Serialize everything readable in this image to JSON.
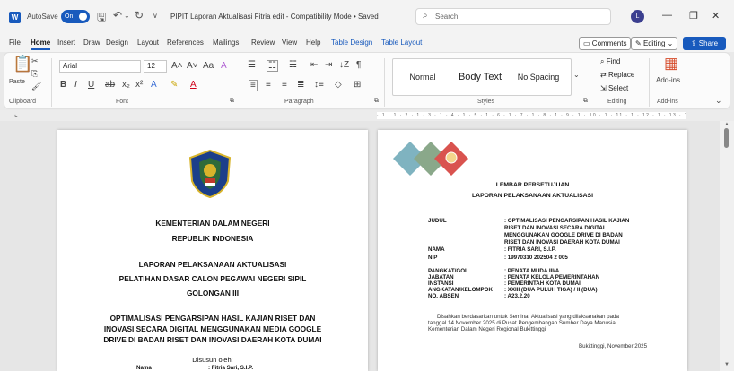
{
  "titlebar": {
    "autosave_label": "AutoSave",
    "autosave_state": "On",
    "doc_title": "PIPIT Laporan Aktualisasi Fitria edit  -  Compatibility Mode  •  Saved",
    "search_placeholder": "Search",
    "avatar_initial": "L"
  },
  "menu": {
    "tabs": [
      "File",
      "Home",
      "Insert",
      "Draw",
      "Design",
      "Layout",
      "References",
      "Mailings",
      "Review",
      "View",
      "Help",
      "Table Design",
      "Table Layout"
    ],
    "comments": "Comments",
    "editing": "Editing",
    "share": "Share"
  },
  "ribbon": {
    "paste": "Paste",
    "font_name": "Arial",
    "font_size": "12",
    "styles": [
      "Normal",
      "Body Text",
      "No Spacing"
    ],
    "find": "Find",
    "replace": "Replace",
    "select": "Select",
    "addins": "Add-ins",
    "groups": {
      "clipboard": "Clipboard",
      "font": "Font",
      "paragraph": "Paragraph",
      "styles": "Styles",
      "editing": "Editing",
      "addins": "Add-ins"
    }
  },
  "ruler": {
    "text": "· 1 · 1 · 2 · 1 · 3 · 1 · 4 · 1 · 5 · 1 · 6 · 1 · 7 · 1 · 8 · 1 · 9 · 1 · 10 · 1 · 11 · 1 · 12 · 1 · 13 · 1 · 14 · 1 · 15 · 1 · 16 · 1 · 17"
  },
  "page_left": {
    "ministry": "KEMENTERIAN DALAM NEGERI",
    "country": "REPUBLIK INDONESIA",
    "report": "LAPORAN PELAKSANAAN AKTUALISASI",
    "training": "PELATIHAN DASAR CALON PEGAWAI NEGERI SIPIL",
    "group": "GOLONGAN III",
    "title_lines": [
      "OPTIMALISASI PENGARSIPAN HASIL KAJIAN RISET DAN",
      "INOVASI SECARA  DIGITAL MENGGUNAKAN  MEDIA GOOGLE",
      "DRIVE DI BADAN RISET DAN INOVASI DAERAH KOTA DUMAI"
    ],
    "prepared_by": "Disusun oleh:",
    "name_label": "Nama",
    "name_value": ": Fitria Sari, S.I.P."
  },
  "page_right": {
    "heading1": "LEMBAR PERSETUJUAN",
    "heading2": "LAPORAN PELAKSANAAN AKTUALISASI",
    "fields": [
      {
        "label": "JUDUL",
        "value": ": OPTIMALISASI PENGARSIPAN HASIL KAJIAN"
      },
      {
        "label": "",
        "value": "  RISET DAN INOVASI SECARA DIGITAL"
      },
      {
        "label": "",
        "value": "  MENGGUNAKAN GOOGLE DRIVE DI BADAN"
      },
      {
        "label": "",
        "value": "  RISET DAN INOVASI DAERAH KOTA DUMAI"
      },
      {
        "label": "NAMA",
        "value": ": FITRIA SARI, S.I.P."
      },
      {
        "label": "NIP",
        "value": ": 19970310 202504 2 005"
      },
      {
        "label": "PANGKAT/GOL.",
        "value": ": PENATA MUDA III/A"
      },
      {
        "label": "JABATAN",
        "value": ": PENATA KELOLA PEMERINTAHAN"
      },
      {
        "label": "INSTANSI",
        "value": ": PEMERINTAH KOTA DUMAI"
      },
      {
        "label": "ANGKATAN/KELOMPOK",
        "value": ": XXIII (DUA PULUH TIGA) / II (DUA)"
      },
      {
        "label": "NO. ABSEN",
        "value": ": A23.2.20"
      }
    ],
    "para_lines": [
      "Disahkan berdasarkan untuk Seminar Aktualisasi yang dilaksanakan pada",
      "tanggal 14 November 2025 di Pusat Pengembangan Sumber Daya Manusia",
      "Kementerian Dalam Negeri Regional Bukittinggi"
    ],
    "place_date": "Bukittinggi,  November 2025"
  },
  "colors": {
    "accent": "#185abd",
    "diamond_teal": "#7fb3c0",
    "diamond_green": "#8aa88a",
    "diamond_red": "#d9534f"
  }
}
